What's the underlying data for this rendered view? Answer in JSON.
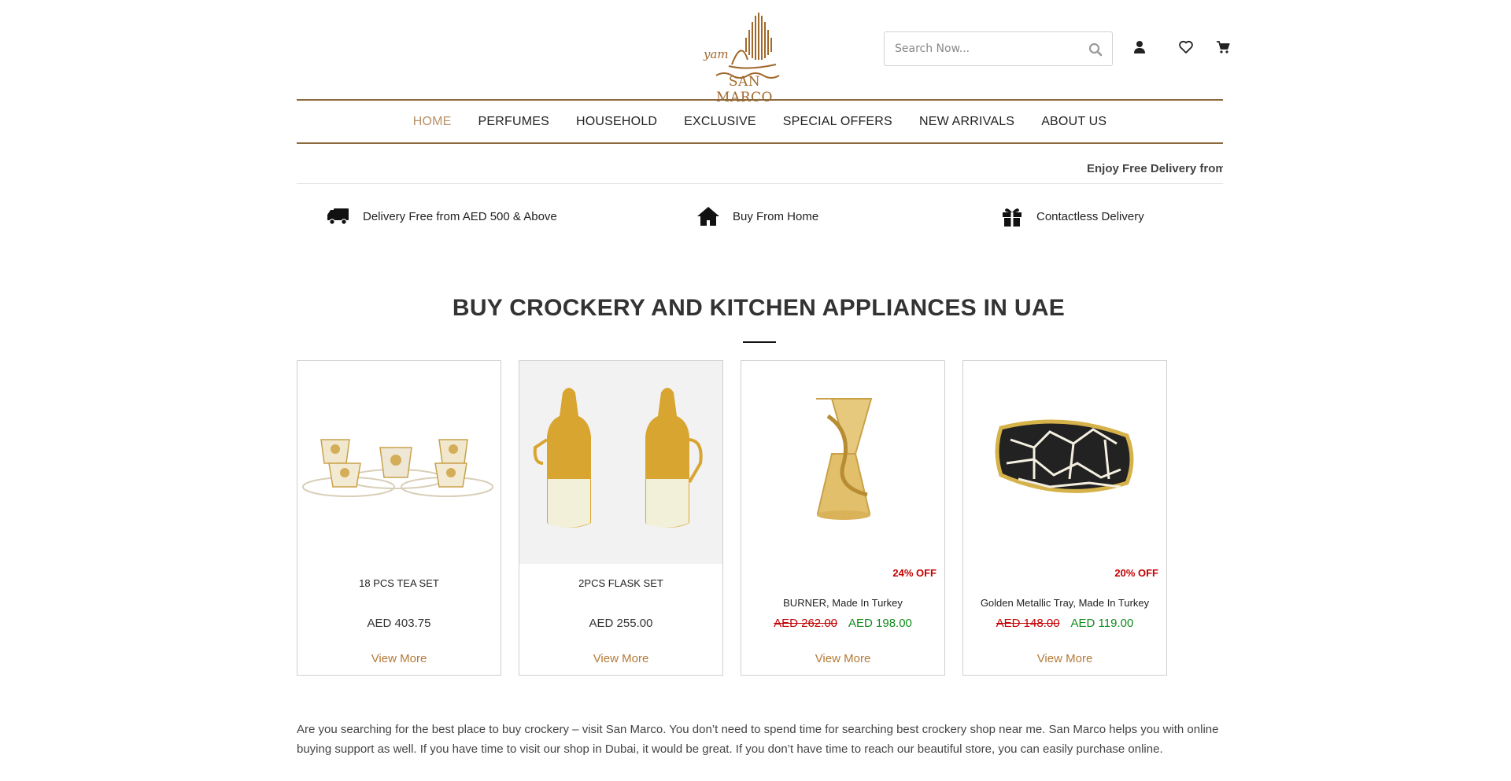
{
  "header": {
    "logo_small": "yam",
    "logo_name": "SAN MARCO",
    "search_placeholder": "Search Now...",
    "icons": [
      "search-icon",
      "user-icon",
      "heart-icon",
      "cart-icon"
    ]
  },
  "nav": {
    "items": [
      "HOME",
      "PERFUMES",
      "HOUSEHOLD",
      "EXCLUSIVE",
      "SPECIAL OFFERS",
      "NEW ARRIVALS",
      "ABOUT US"
    ],
    "active": "HOME"
  },
  "marquee": {
    "text": "Enjoy Free Delivery from"
  },
  "features": [
    {
      "icon": "truck-icon",
      "label": "Delivery Free from AED 500 & Above"
    },
    {
      "icon": "home-icon",
      "label": "Buy From Home"
    },
    {
      "icon": "gift-icon",
      "label": "Contactless Delivery"
    }
  ],
  "section": {
    "title": "BUY CROCKERY AND KITCHEN APPLIANCES IN UAE"
  },
  "products": [
    {
      "name": "18 PCS TEA SET",
      "price": "AED 403.75",
      "old_price": "",
      "new_price": "",
      "badge": "",
      "cta": "View More"
    },
    {
      "name": "2PCS FLASK SET",
      "price": "AED 255.00",
      "old_price": "",
      "new_price": "",
      "badge": "",
      "cta": "View More"
    },
    {
      "name": "BURNER, Made In Turkey",
      "price": "",
      "old_price": "AED 262.00",
      "new_price": "AED 198.00",
      "badge": "24% OFF",
      "cta": "View More"
    },
    {
      "name": "Golden Metallic Tray, Made In Turkey",
      "price": "",
      "old_price": "AED 148.00",
      "new_price": "AED 119.00",
      "badge": "20% OFF",
      "cta": "View More"
    }
  ],
  "description": "Are you searching for the best place to buy crockery – visit San Marco.  You don’t need to spend time for searching best crockery shop near me. San Marco helps you with online buying support as well. If you have time to visit our shop in Dubai, it would be great. If you don’t have time to reach our beautiful store, you can easily purchase online.",
  "colors": {
    "brand_gold": "#a0682a",
    "nav_active": "#b89067",
    "rule": "#8c6a3f",
    "discount_red": "#c40000",
    "sale_green": "#118a1e",
    "link": "#b37a37"
  }
}
